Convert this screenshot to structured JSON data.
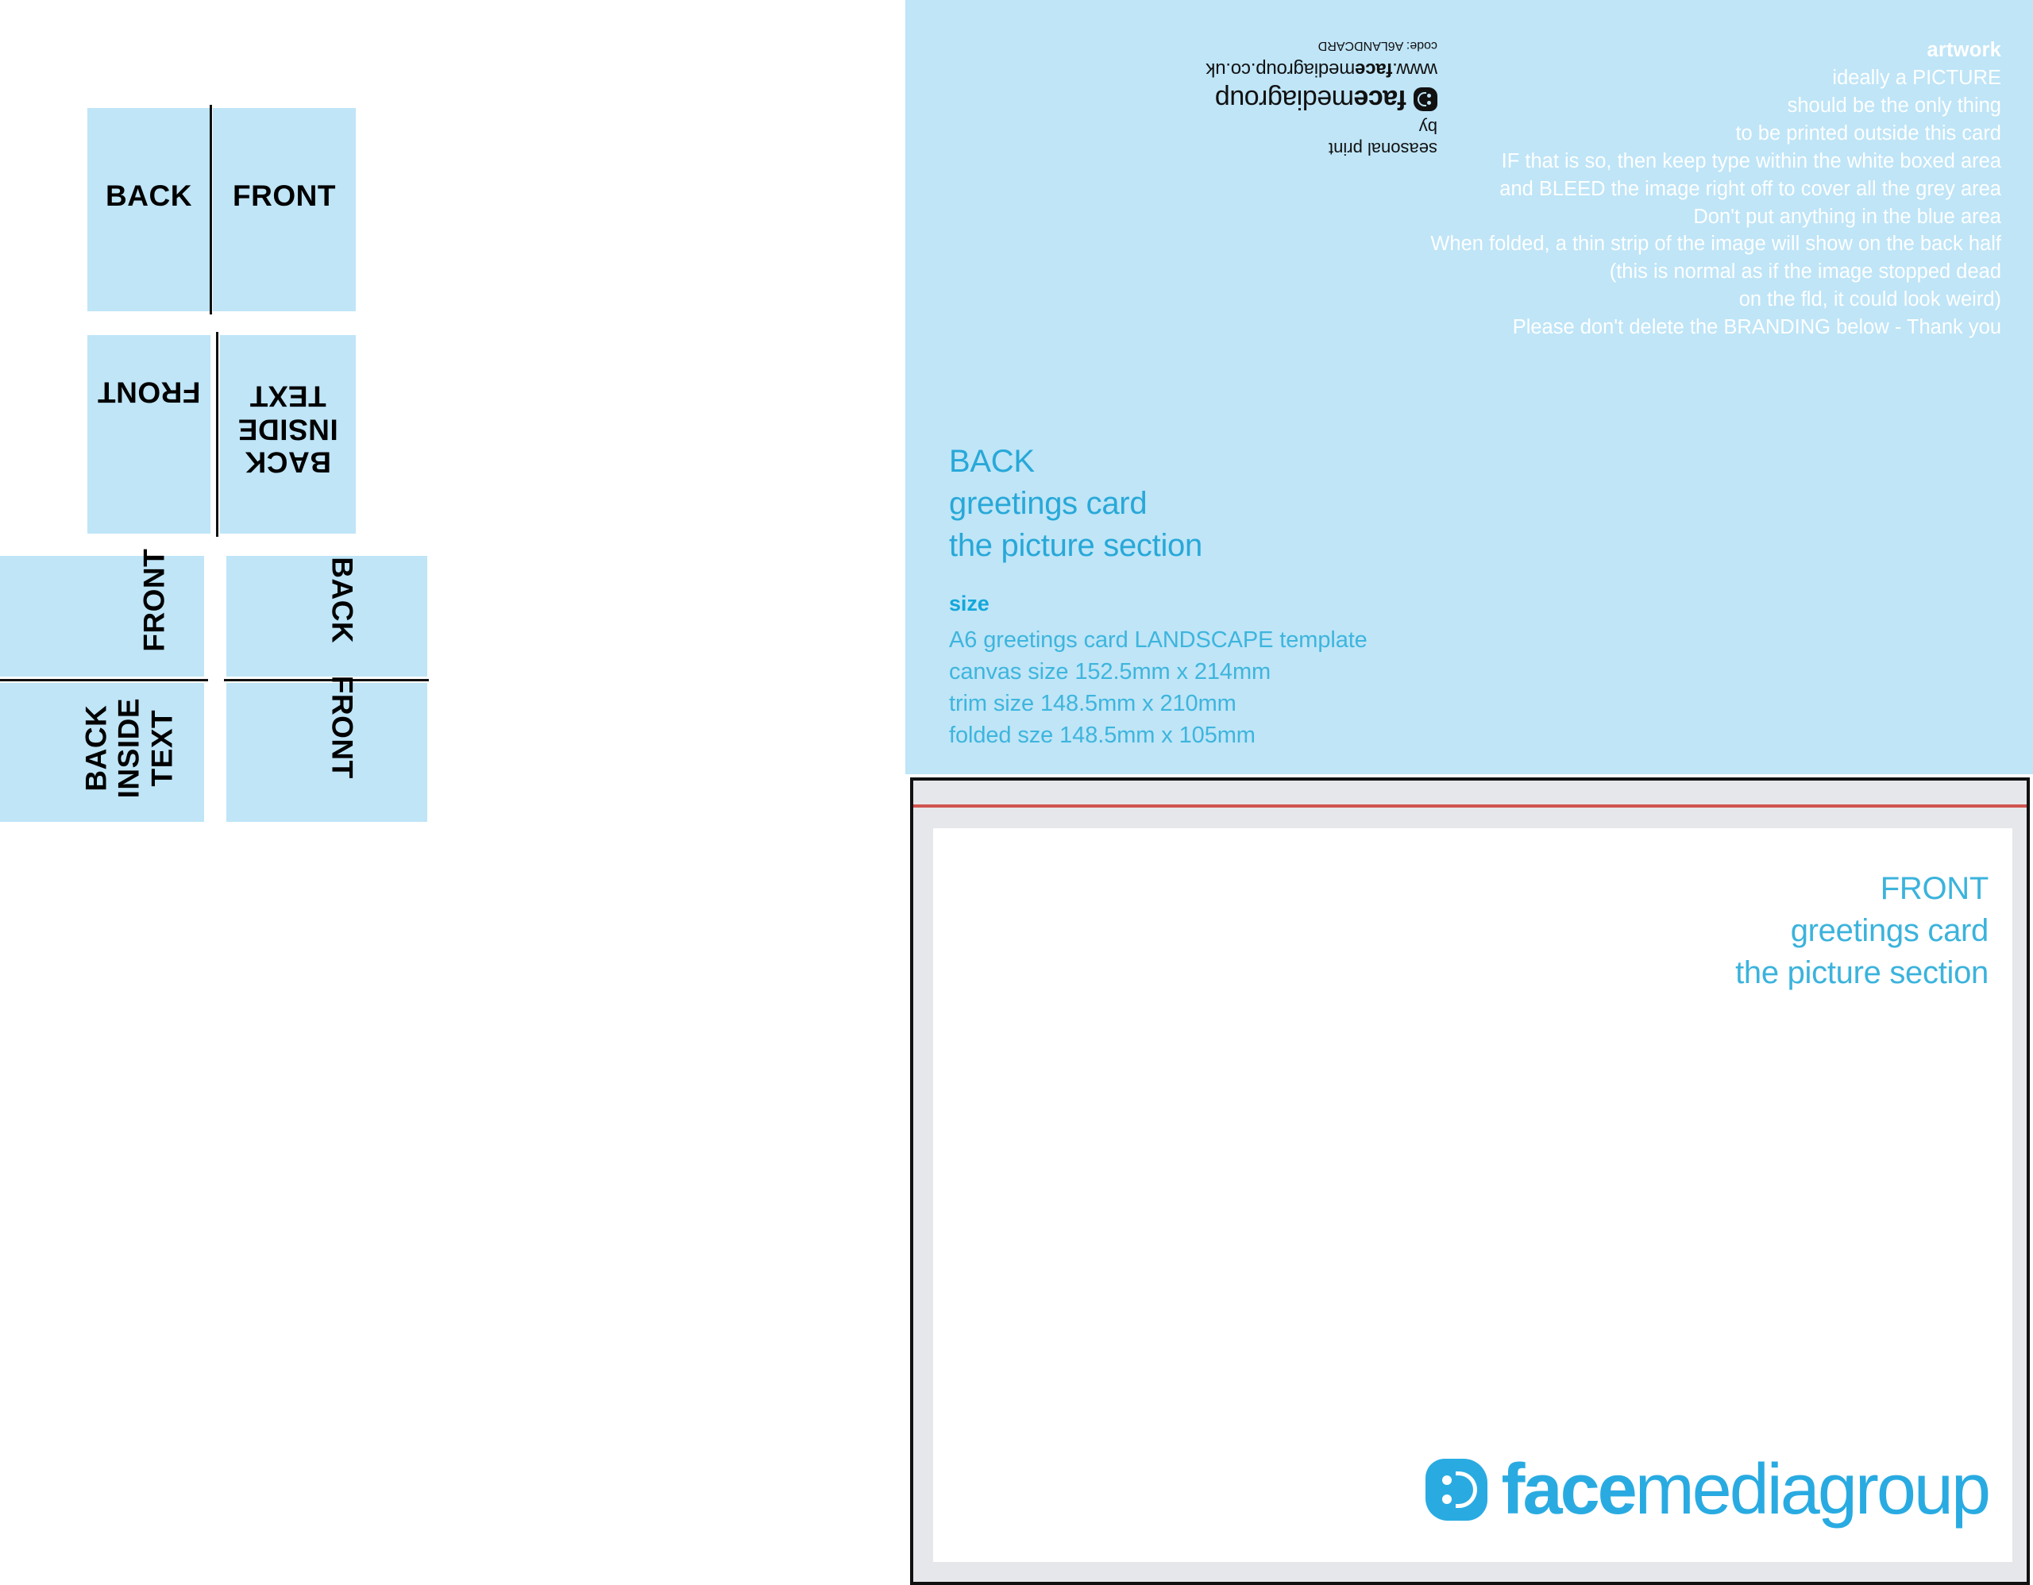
{
  "labels": {
    "back": "BACK",
    "front": "FRONT",
    "back_inside_text": "BACK\nINSIDE\nTEXT"
  },
  "diagrams": [
    {
      "name": "flat-unfolded",
      "panels": [
        {
          "label": "BACK"
        },
        {
          "label": "FRONT"
        }
      ]
    },
    {
      "name": "inside-spread",
      "panels": [
        {
          "label": "FRONT"
        },
        {
          "label": "BACK\nINSIDE\nTEXT"
        }
      ]
    },
    {
      "name": "rotated-spread",
      "panels": [
        {
          "label": "FRONT"
        },
        {
          "label": "BACK\nINSIDE\nTEXT"
        },
        {
          "label": "BACK"
        },
        {
          "label": "FRONT"
        }
      ]
    }
  ],
  "branding_flipped": {
    "seasonal": "seasonal print",
    "by": "by",
    "wordmark_bold": "face",
    "wordmark_rest": "mediagroup",
    "url_prefix": "www.",
    "url_bold": "face",
    "url_rest": "mediagroup.co.uk",
    "code": "code: A6LANDCARD"
  },
  "artwork_note": {
    "heading": "artwork",
    "lines": [
      "ideally a PICTURE",
      "should be the only thing",
      "to be printed outside this card",
      "IF that is so, then keep type within the white boxed area",
      "and BLEED the image right off to cover all the grey area",
      "Don't put anything in the blue area",
      "When folded, a thin strip of the image will show on the back half",
      "(this is normal as if the image stopped dead",
      "on the fld, it could look weird)",
      "Please don't delete the BRANDING below - Thank you"
    ]
  },
  "back_section": {
    "line1": "BACK",
    "line2": "greetings card",
    "line3": "the picture section"
  },
  "size_section": {
    "heading": "size",
    "lines": [
      "A6 greetings card LANDSCAPE template",
      "canvas size 152.5mm x 214mm",
      "trim size 148.5mm x 210mm",
      "folded sze 148.5mm x 105mm"
    ]
  },
  "front_section": {
    "line1": "FRONT",
    "line2": "greetings card",
    "line3": "the picture section"
  },
  "logo": {
    "bold": "face",
    "rest": "mediagroup"
  },
  "colors": {
    "blue_area": "#bfe5f7",
    "accent_cyan": "#29abe2",
    "heading_cyan": "#3bb3dc",
    "trim_red": "#d0544f",
    "bleed_grey": "#e6e7ea",
    "white": "#ffffff",
    "black": "#111111"
  }
}
